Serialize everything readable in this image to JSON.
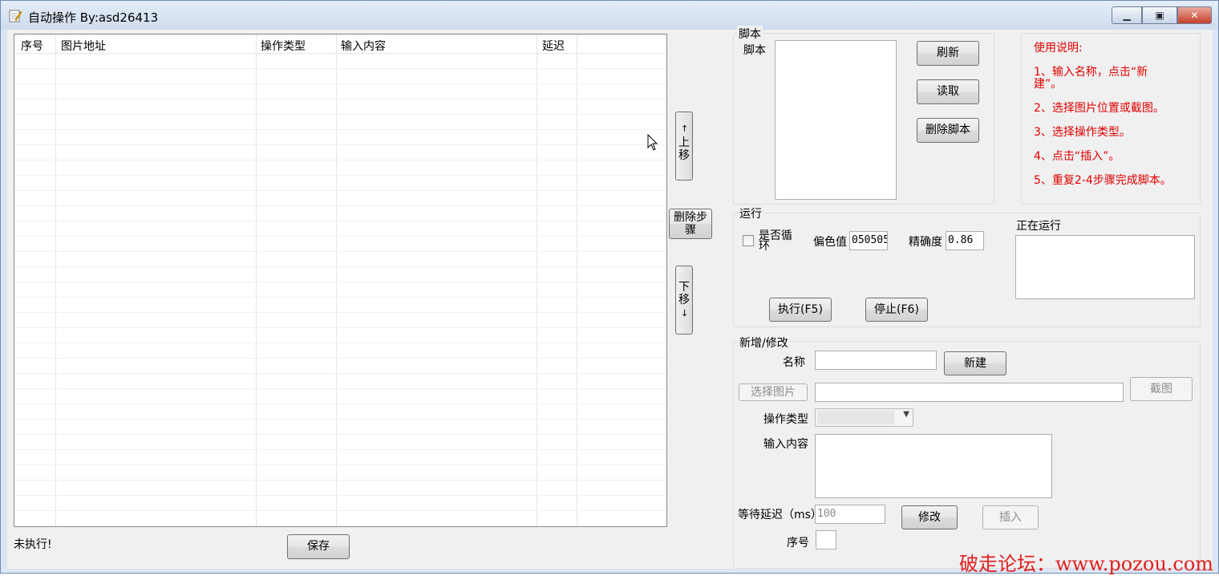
{
  "window": {
    "title": "自动操作 By:asd26413"
  },
  "grid": {
    "columns": [
      "序号",
      "图片地址",
      "操作类型",
      "输入内容",
      "延迟"
    ]
  },
  "steps": {
    "move_up": "上移",
    "delete": "删除步骤",
    "move_down": "下移"
  },
  "status_text": "未执行!",
  "save_label": "保存",
  "script_panel": {
    "group_label": "脚本",
    "list_label": "脚本",
    "refresh": "刷新",
    "load": "读取",
    "delete_script": "删除脚本"
  },
  "help": {
    "title": "使用说明:",
    "lines": [
      "1、输入名称，点击“新",
      "建”。",
      "2、选择图片位置或截图。",
      "3、选择操作类型。",
      "4、点击“插入”。",
      "5、重复2-4步骤完成脚本。"
    ]
  },
  "run_panel": {
    "group_label": "运行",
    "loop_label_1": "是否循",
    "loop_label_2": "环",
    "loop_checked": false,
    "color_offset_label": "偏色值",
    "color_offset_value": "050505",
    "precision_label": "精确度",
    "precision_value": "0.86",
    "running_label": "正在运行",
    "execute": "执行(F5)",
    "stop": "停止(F6)"
  },
  "edit_panel": {
    "group_label": "新增/修改",
    "name_label": "名称",
    "name_value": "",
    "new_button": "新建",
    "select_image": "选择图片",
    "image_path": "",
    "screenshot": "截图",
    "op_type_label": "操作类型",
    "op_type_value": "",
    "input_label": "输入内容",
    "input_value": "",
    "delay_label": "等待延迟（ms）",
    "delay_placeholder": "100",
    "modify": "修改",
    "insert": "插入",
    "index_label": "序号",
    "index_value": ""
  },
  "watermark": "破走论坛：www.pozou.com",
  "colors": {
    "help_text": "#e00000",
    "watermark": "#e02020",
    "titlebar": "#dbe6f4"
  },
  "icons": [
    "app-icon",
    "minimize-icon",
    "maximize-icon",
    "close-icon",
    "arrow-up-icon",
    "arrow-down-icon",
    "dropdown-arrow-icon",
    "mouse-cursor-icon"
  ]
}
